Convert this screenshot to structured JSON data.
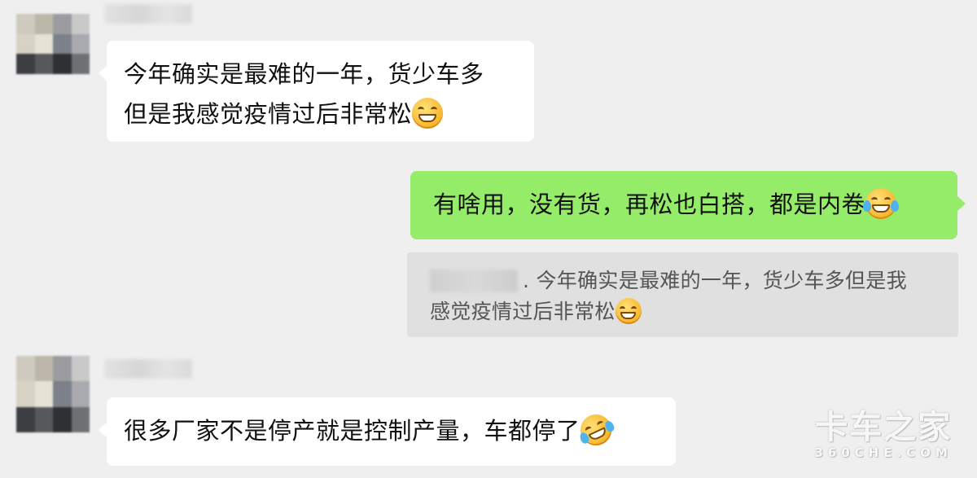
{
  "messages": {
    "msg1": {
      "line1": "今年确实是最难的一年，货少车多",
      "line2": "但是我感觉疫情过后非常松",
      "emoji": "grinning-face-icon"
    },
    "msg2": {
      "text": "有啥用，没有货，再松也白搭，都是内卷",
      "emoji": "tears-of-joy-icon",
      "quote": {
        "line1": ". 今年确实是最难的一年，货少车多但是我",
        "line2": "感觉疫情过后非常松",
        "emoji": "grinning-face-icon"
      }
    },
    "msg3": {
      "text": "很多厂家不是停产就是控制产量，车都停了",
      "emoji": "rolling-laughing-face-icon"
    }
  },
  "colors": {
    "background": "#efefef",
    "incoming_bubble": "#ffffff",
    "outgoing_bubble": "#95ec69",
    "quote_bg": "#e0e0e0"
  },
  "watermark": {
    "main": "卡车之家",
    "sub": "360CHE.COM"
  }
}
